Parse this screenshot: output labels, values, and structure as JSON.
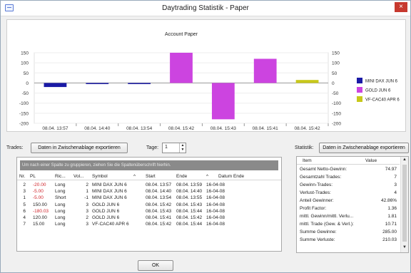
{
  "window": {
    "title": "Daytrading Statistik - Paper",
    "close_label": "×"
  },
  "chart_data": {
    "type": "bar",
    "title": "Account Paper",
    "categories": [
      "08.04. 13:57",
      "08.04. 14:40",
      "08.04. 13:54",
      "08.04. 15:42",
      "08.04. 15:43",
      "08.04. 15:41",
      "08.04. 15:42"
    ],
    "values": [
      -20,
      -5,
      -5,
      150,
      -180,
      120,
      15
    ],
    "colors": [
      "#1a1aa6",
      "#1a1aa6",
      "#1a1aa6",
      "#cc44e0",
      "#cc44e0",
      "#cc44e0",
      "#c8c81a"
    ],
    "ylim": [
      -200,
      150
    ],
    "yticks": [
      "150",
      "100",
      "50",
      "0",
      "-50",
      "-100",
      "-150",
      "-200"
    ],
    "legend": [
      {
        "name": "MINI DAX JUN 6",
        "color": "#1a1aa6"
      },
      {
        "name": "GOLD JUN 6",
        "color": "#cc44e0"
      },
      {
        "name": "VF-CAC40 APR 6",
        "color": "#c8c81a"
      }
    ]
  },
  "trades": {
    "label": "Trades:",
    "export_label": "Daten in Zwischenablage exportieren",
    "days_label": "Tage:",
    "days_value": "1",
    "group_hint": "Um nach einer Spalte zu gruppieren, ziehen Sie die Spaltenüberschrift hierhin.",
    "columns": [
      "Nr.",
      "PL",
      "Ric...",
      "Vol...",
      "Symbol",
      "^",
      "Start",
      "Ende",
      "^",
      "Datum Ende"
    ],
    "rows": [
      {
        "nr": "2",
        "pl": "-20.00",
        "ric": "Long",
        "vol": "2",
        "symbol": "MINI DAX JUN 6",
        "start": "08.04. 13:57",
        "ende": "08.04. 13:59",
        "datum": "16-04-08",
        "neg": true
      },
      {
        "nr": "3",
        "pl": "-5.00",
        "ric": "Long",
        "vol": "1",
        "symbol": "MINI DAX JUN 6",
        "start": "08.04. 14:40",
        "ende": "08.04. 14:40",
        "datum": "16-04-08",
        "neg": true
      },
      {
        "nr": "1",
        "pl": "-5.00",
        "ric": "Short",
        "vol": "-1",
        "symbol": "MINI DAX JUN 6",
        "start": "08.04. 13:54",
        "ende": "08.04. 13:55",
        "datum": "16-04-08",
        "neg": true
      },
      {
        "nr": "5",
        "pl": "150.00",
        "ric": "Long",
        "vol": "3",
        "symbol": "GOLD JUN 6",
        "start": "08.04. 15:42",
        "ende": "08.04. 15:43",
        "datum": "16-04-08",
        "neg": false
      },
      {
        "nr": "6",
        "pl": "-180.03",
        "ric": "Long",
        "vol": "3",
        "symbol": "GOLD JUN 6",
        "start": "08.04. 15:43",
        "ende": "08.04. 15:44",
        "datum": "16-04-08",
        "neg": true
      },
      {
        "nr": "4",
        "pl": "120.00",
        "ric": "Long",
        "vol": "2",
        "symbol": "GOLD JUN 6",
        "start": "08.04. 15:41",
        "ende": "08.04. 15:42",
        "datum": "16-04-08",
        "neg": false
      },
      {
        "nr": "7",
        "pl": "15.00",
        "ric": "Long",
        "vol": "3",
        "symbol": "VF-CAC40 APR 6",
        "start": "08.04. 15:42",
        "ende": "08.04. 15:44",
        "datum": "16-04-08",
        "neg": false
      }
    ]
  },
  "statistik": {
    "label": "Statistik:",
    "export_label": "Daten in Zwischenablage exportieren",
    "columns": [
      "Item",
      "Value"
    ],
    "rows": [
      {
        "item": "Gesamt Netto-Gewinn:",
        "value": "74.97"
      },
      {
        "item": "Gesamtzahl Trades:",
        "value": "7"
      },
      {
        "item": "Gewinn-Trades:",
        "value": "3"
      },
      {
        "item": "Verlust-Trades:",
        "value": "4"
      },
      {
        "item": "Anteil Gewinner:",
        "value": "42.86%"
      },
      {
        "item": "Profit Factor:",
        "value": "1.36"
      },
      {
        "item": "mittl. Gewinn/mittl. Verlu...",
        "value": "1.81"
      },
      {
        "item": "mittl. Trade (Gew. & Verl.):",
        "value": "10.71"
      },
      {
        "item": "Summe Gewinne:",
        "value": "285.00"
      },
      {
        "item": "Summe Verluste:",
        "value": "210.03"
      }
    ]
  },
  "ok_label": "OK"
}
